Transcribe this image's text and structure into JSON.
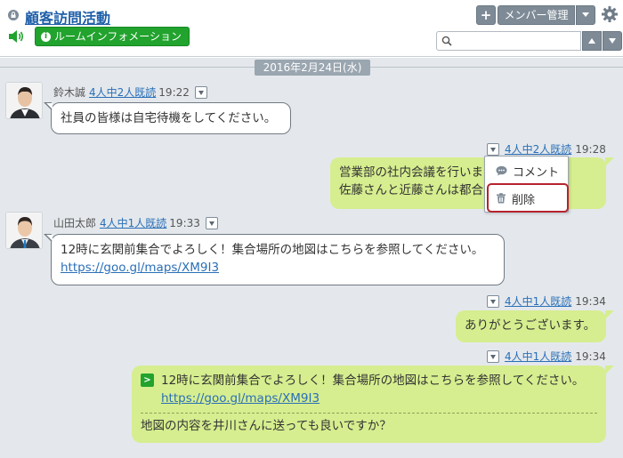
{
  "header": {
    "title": "顧客訪問活動",
    "room_info_label": "ルームインフォメーション",
    "add_label": "+",
    "member_label": "メンバー管理",
    "search_placeholder": ""
  },
  "date_label": "2016年2月24日(水)",
  "messages": [
    {
      "side": "left",
      "sender": "鈴木誠",
      "read": "4人中2人既読",
      "time": "19:22",
      "text": "社員の皆様は自宅待機をしてください。"
    },
    {
      "side": "right",
      "read": "4人中2人既読",
      "time": "19:28",
      "lines": [
        "営業部の社内会議を行います。",
        "佐藤さんと近藤さんは都合がつきます。"
      ]
    },
    {
      "side": "left",
      "sender": "山田太郎",
      "read": "4人中1人既読",
      "time": "19:33",
      "text": "12時に玄関前集合でよろしく！集合場所の地図はこちらを参照してください。",
      "link": "https://goo.gl/maps/XM9I3"
    },
    {
      "side": "right",
      "read": "4人中1人既読",
      "time": "19:34",
      "text": "ありがとうございます。"
    },
    {
      "side": "right",
      "read": "4人中1人既読",
      "time": "19:34",
      "quote_mark": ">",
      "quote_text": "12時に玄関前集合でよろしく！集合場所の地図はこちらを参照してください。",
      "quote_link": "https://goo.gl/maps/XM9I3",
      "text": "地図の内容を井川さんに送っても良いですか？"
    }
  ],
  "popup": {
    "comment_label": "コメント",
    "delete_label": "削除"
  },
  "colors": {
    "title": "#1f5fa8",
    "room_info_bg": "#21a32d",
    "right_bubble": "#d6ee8f",
    "chat_bg": "#e4e8ec",
    "highlight": "#b5232e"
  }
}
